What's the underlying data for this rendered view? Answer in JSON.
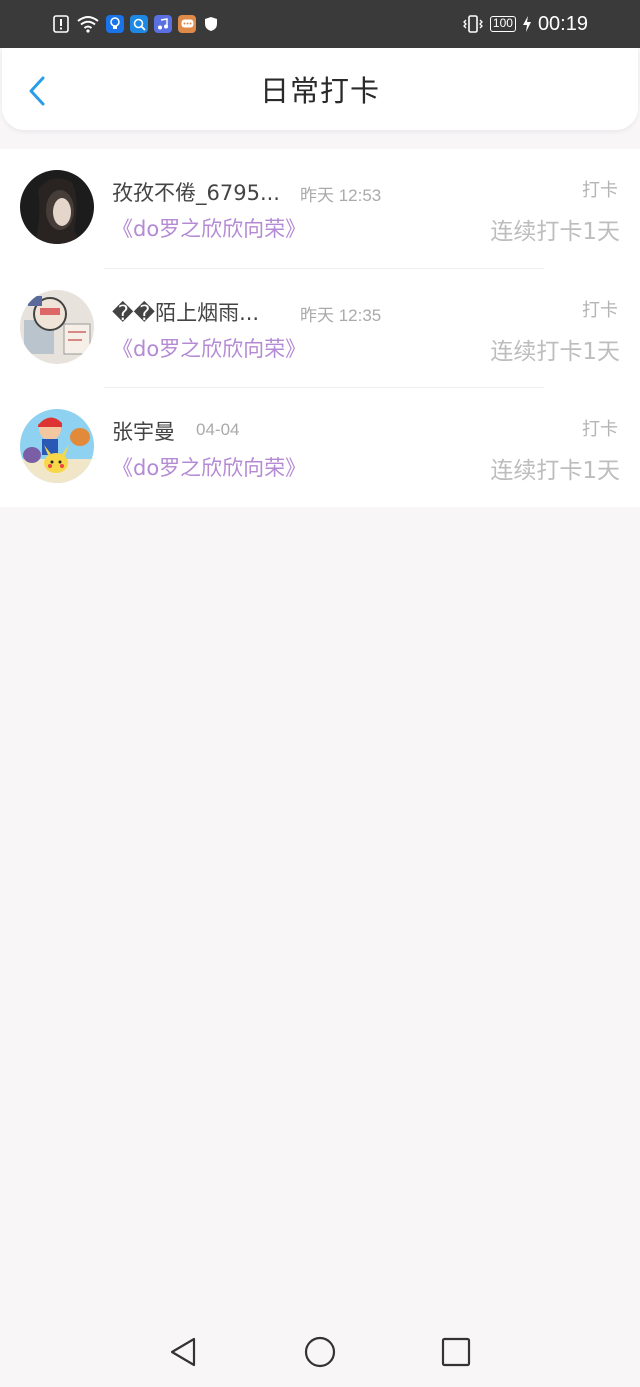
{
  "status_bar": {
    "time": "00:19",
    "battery": "100",
    "icons": [
      "alert-icon",
      "wifi-icon",
      "bulb-app-icon",
      "search-app-icon",
      "music-app-icon",
      "message-app-icon",
      "shield-icon",
      "vibrate-icon",
      "charging-icon"
    ]
  },
  "header": {
    "title": "日常打卡",
    "back_icon": "chevron-left-icon",
    "accent_color": "#2a9de8"
  },
  "checkins": [
    {
      "name": "孜孜不倦_6795...",
      "time": "昨天 12:53",
      "book": "《do罗之欣欣向荣》",
      "tag": "打卡",
      "streak": "连续打卡1天"
    },
    {
      "name": "��陌上烟雨...",
      "time": "昨天 12:35",
      "book": "《do罗之欣欣向荣》",
      "tag": "打卡",
      "streak": "连续打卡1天"
    },
    {
      "name": "张宇曼",
      "time": "04-04",
      "book": "《do罗之欣欣向荣》",
      "tag": "打卡",
      "streak": "连续打卡1天"
    }
  ],
  "colors": {
    "book_title": "#b48ad4",
    "muted": "#bdbdbd",
    "background": "#f8f6f7"
  },
  "nav_bar": {
    "buttons": [
      "back-triangle-icon",
      "home-circle-icon",
      "recents-square-icon"
    ]
  }
}
